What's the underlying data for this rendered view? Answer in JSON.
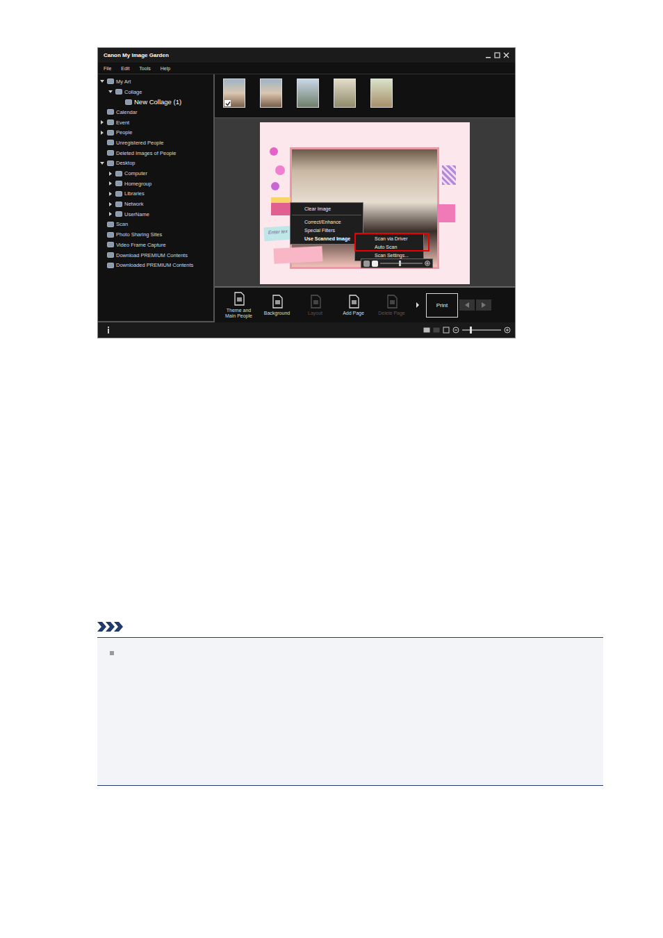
{
  "window": {
    "title": "Canon My Image Garden"
  },
  "menu": [
    "File",
    "Edit",
    "Tools",
    "Help"
  ],
  "sidebar": {
    "items": [
      {
        "label": "My Art",
        "level": 0,
        "kind": "branch",
        "expanded": true,
        "selected": false
      },
      {
        "label": "Collage",
        "level": 1,
        "kind": "branch",
        "expanded": true,
        "selected": false
      },
      {
        "label": "New Collage (1)",
        "level": 2,
        "kind": "leaf",
        "expanded": false,
        "selected": true
      },
      {
        "label": "Calendar",
        "level": 0,
        "kind": "leaf",
        "expanded": false,
        "selected": false
      },
      {
        "label": "Event",
        "level": 0,
        "kind": "branch",
        "expanded": false,
        "selected": false
      },
      {
        "label": "People",
        "level": 0,
        "kind": "branch",
        "expanded": false,
        "selected": false
      },
      {
        "label": "Unregistered People",
        "level": 0,
        "kind": "leaf",
        "expanded": false,
        "selected": false
      },
      {
        "label": "Deleted Images of People",
        "level": 0,
        "kind": "leaf",
        "expanded": false,
        "selected": false
      },
      {
        "label": "Desktop",
        "level": 0,
        "kind": "branch",
        "expanded": true,
        "selected": false
      },
      {
        "label": "Computer",
        "level": 1,
        "kind": "branch",
        "expanded": false,
        "selected": false
      },
      {
        "label": "Homegroup",
        "level": 1,
        "kind": "branch",
        "expanded": false,
        "selected": false
      },
      {
        "label": "Libraries",
        "level": 1,
        "kind": "branch",
        "expanded": false,
        "selected": false
      },
      {
        "label": "Network",
        "level": 1,
        "kind": "branch",
        "expanded": false,
        "selected": false
      },
      {
        "label": "UserName",
        "level": 1,
        "kind": "branch",
        "expanded": false,
        "selected": false
      },
      {
        "label": "Scan",
        "level": 0,
        "kind": "leaf",
        "expanded": false,
        "selected": false
      },
      {
        "label": "Photo Sharing Sites",
        "level": 0,
        "kind": "leaf",
        "expanded": false,
        "selected": false
      },
      {
        "label": "Video Frame Capture",
        "level": 0,
        "kind": "leaf",
        "expanded": false,
        "selected": false
      },
      {
        "label": "Download PREMIUM Contents",
        "level": 0,
        "kind": "leaf",
        "expanded": false,
        "selected": false
      },
      {
        "label": "Downloaded PREMIUM Contents",
        "level": 0,
        "kind": "leaf",
        "expanded": false,
        "selected": false
      }
    ]
  },
  "thumbnails": [
    {
      "checked": true
    },
    {
      "checked": false
    },
    {
      "checked": false
    },
    {
      "checked": false
    },
    {
      "checked": false
    }
  ],
  "collage": {
    "ribbon_text": "Enter tex"
  },
  "context_menu": {
    "items": [
      {
        "kind": "item",
        "label": "Clear Image",
        "open": false
      },
      {
        "kind": "separator",
        "label": "",
        "open": false
      },
      {
        "kind": "item",
        "label": "Correct/Enhance",
        "open": false
      },
      {
        "kind": "item",
        "label": "Special Filters",
        "open": false
      },
      {
        "kind": "submenu",
        "label": "Use Scanned Image",
        "open": true
      }
    ]
  },
  "submenu": {
    "items": [
      {
        "label": "Scan via Driver",
        "highlighted": true
      },
      {
        "label": "Auto Scan",
        "highlighted": true
      },
      {
        "label": "Scan Settings...",
        "highlighted": false
      }
    ]
  },
  "photo_toolbar": {
    "zoom_level": 0.45
  },
  "toolbar": {
    "buttons": [
      {
        "label": "Theme and Main People",
        "disabled": false
      },
      {
        "label": "Background",
        "disabled": false
      },
      {
        "label": "Layout",
        "disabled": true
      },
      {
        "label": "Add Page",
        "disabled": false
      },
      {
        "label": "Delete Page",
        "disabled": true
      }
    ],
    "print": "Print"
  },
  "status_bar": {
    "zoom_level": 0.2
  },
  "note": {
    "items": [
      {
        "text": ""
      }
    ]
  }
}
